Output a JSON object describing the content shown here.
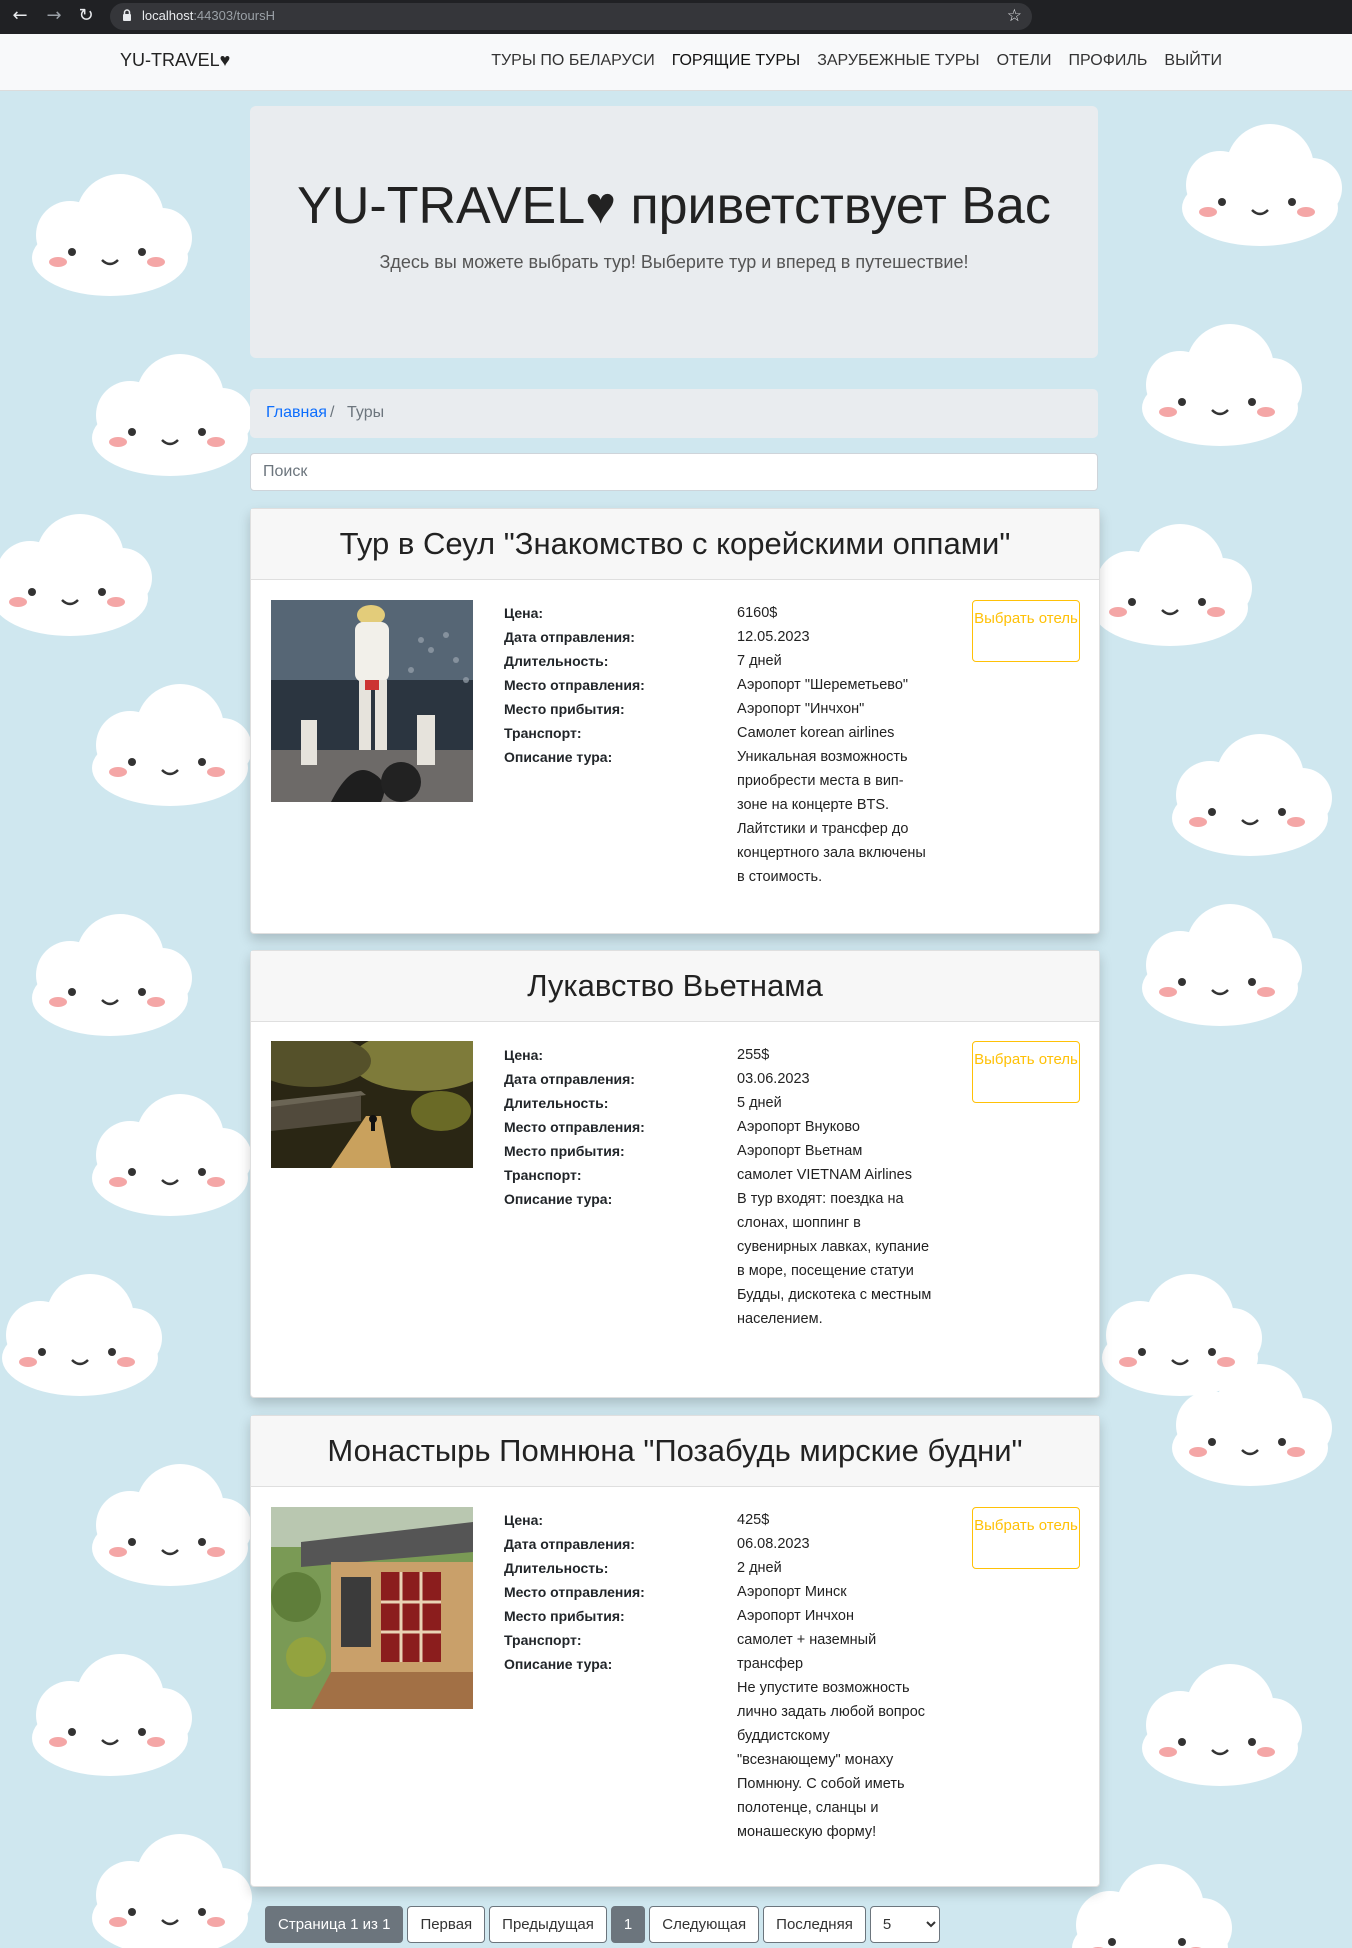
{
  "browser": {
    "url_host": "localhost",
    "url_path": ":44303/toursH"
  },
  "navbar": {
    "brand": "YU-TRAVEL♥",
    "links": [
      "ТУРЫ ПО БЕЛАРУСИ",
      "ГОРЯЩИЕ ТУРЫ",
      "ЗАРУБЕЖНЫЕ ТУРЫ",
      "ОТЕЛИ",
      "ПРОФИЛЬ",
      "ВЫЙТИ"
    ]
  },
  "hero": {
    "title": "YU-TRAVEL♥ приветствует Вас",
    "subtitle": "Здесь вы можете выбрать тур! Выберите тур и вперед в путешествие!"
  },
  "breadcrumb": {
    "home": "Главная",
    "separator": "/",
    "current": "Туры"
  },
  "search": {
    "placeholder": "Поиск"
  },
  "labels": {
    "price": "Цена:",
    "date": "Дата отправления:",
    "duration": "Длительность:",
    "from": "Место отправления:",
    "to": "Место прибытия:",
    "transport": "Транспорт:",
    "description": "Описание тура:",
    "hotel_button": "Выбрать отель"
  },
  "tours": [
    {
      "title": "Тур в Сеул \"Знакомство с корейскими оппами\"",
      "price": "6160$",
      "date": "12.05.2023",
      "duration": "7 дней",
      "from": "Аэропорт \"Шереметьево\"",
      "to": "Аэропорт \"Инчхон\"",
      "transport": "Самолет korean airlines",
      "description": "Уникальная возможность приобрести места в вип-зоне на концерте BTS. Лайтстики и трансфер до концертного зала включены в стоимость."
    },
    {
      "title": "Лукавство Вьетнама",
      "price": "255$",
      "date": "03.06.2023",
      "duration": "5 дней",
      "from": "Аэропорт Внуково",
      "to": "Аэропорт Вьетнам",
      "transport": "самолет VIETNAM Airlines",
      "description": "В тур входят: поездка на слонах, шоппинг в сувенирных лавках, купание в море, посещение статуи Будды, дискотека с местным населением."
    },
    {
      "title": "Монастырь Помнюна \"Позабудь мирские будни\"",
      "price": "425$",
      "date": "06.08.2023",
      "duration": "2 дней",
      "from": "Аэропорт Минск",
      "to": "Аэропорт Инчхон",
      "transport": "самолет + наземный трансфер",
      "description": "Не упустите возможность лично задать любой вопрос буддистскому \"всезнающему\" монаху Помнюну. С собой иметь полотенце, сланцы и монашескую форму!"
    }
  ],
  "pager": {
    "info": "Страница 1 из 1",
    "first": "Первая",
    "prev": "Предыдущая",
    "current": "1",
    "next": "Следующая",
    "last": "Последняя",
    "page_size": "5"
  },
  "colors": {
    "background": "#cfe7ef",
    "link": "#0d6efd",
    "hotel_button": "#ffc107",
    "pager": "#6c757d"
  }
}
